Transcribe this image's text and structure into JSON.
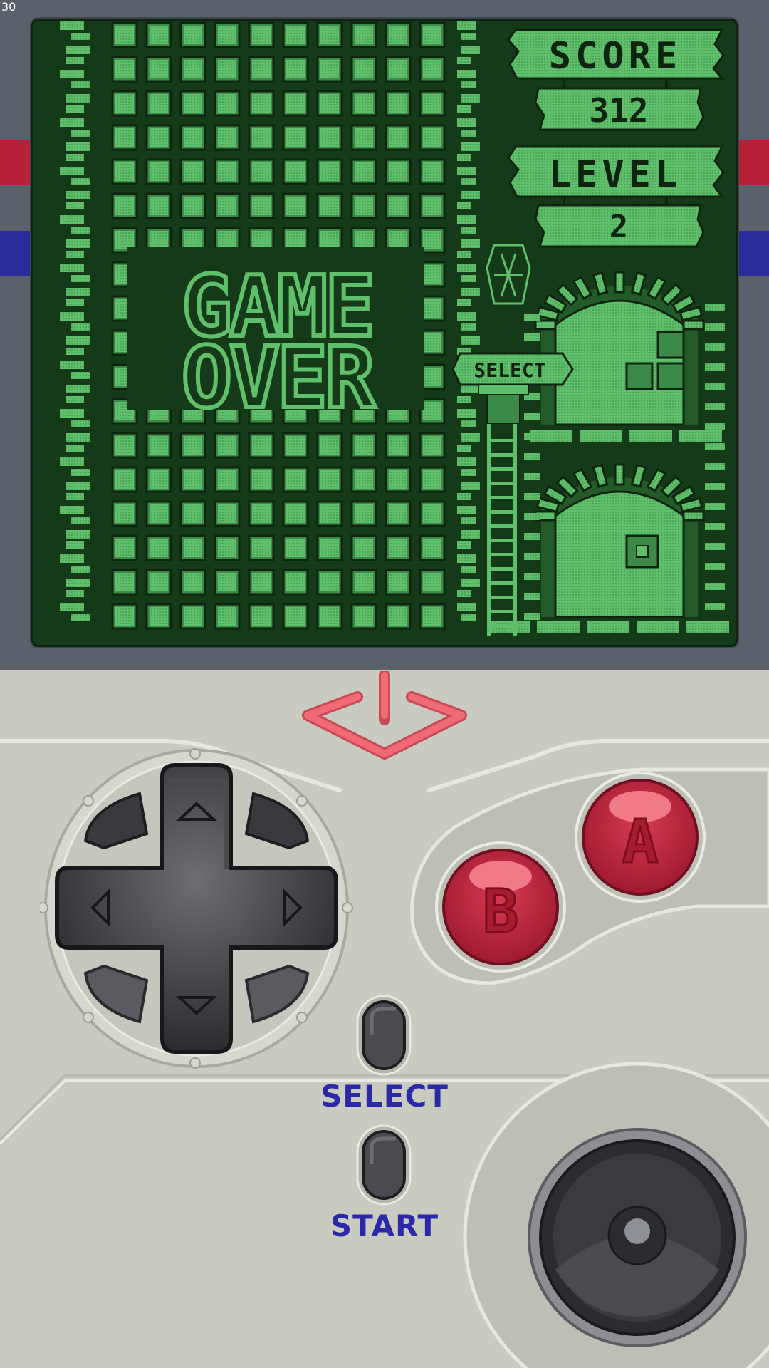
{
  "hud": {
    "fps_counter": "30",
    "score_label": "SCORE",
    "score_value": "312",
    "level_label": "LEVEL",
    "level_value": "2",
    "select_sign": "SELECT"
  },
  "game": {
    "status_line1": "GAME",
    "status_line2": "OVER"
  },
  "controls": {
    "button_a_label": "A",
    "button_b_label": "B",
    "select_label": "SELECT",
    "start_label": "START"
  },
  "icons": {
    "logo": "power-logo-icon",
    "dpad": "dpad-icon",
    "speaker": "speaker-icon"
  },
  "colors": {
    "screen_dark": "#153a19",
    "screen_light": "#5fbf6a",
    "bezel": "#5a616a",
    "body": "#c9cbc0",
    "button_red": "#c02a40",
    "label_blue": "#2a2aa8",
    "logo_pink": "#f06a78",
    "stripe_red": "#b8203a",
    "stripe_blue": "#2a2a9a"
  }
}
